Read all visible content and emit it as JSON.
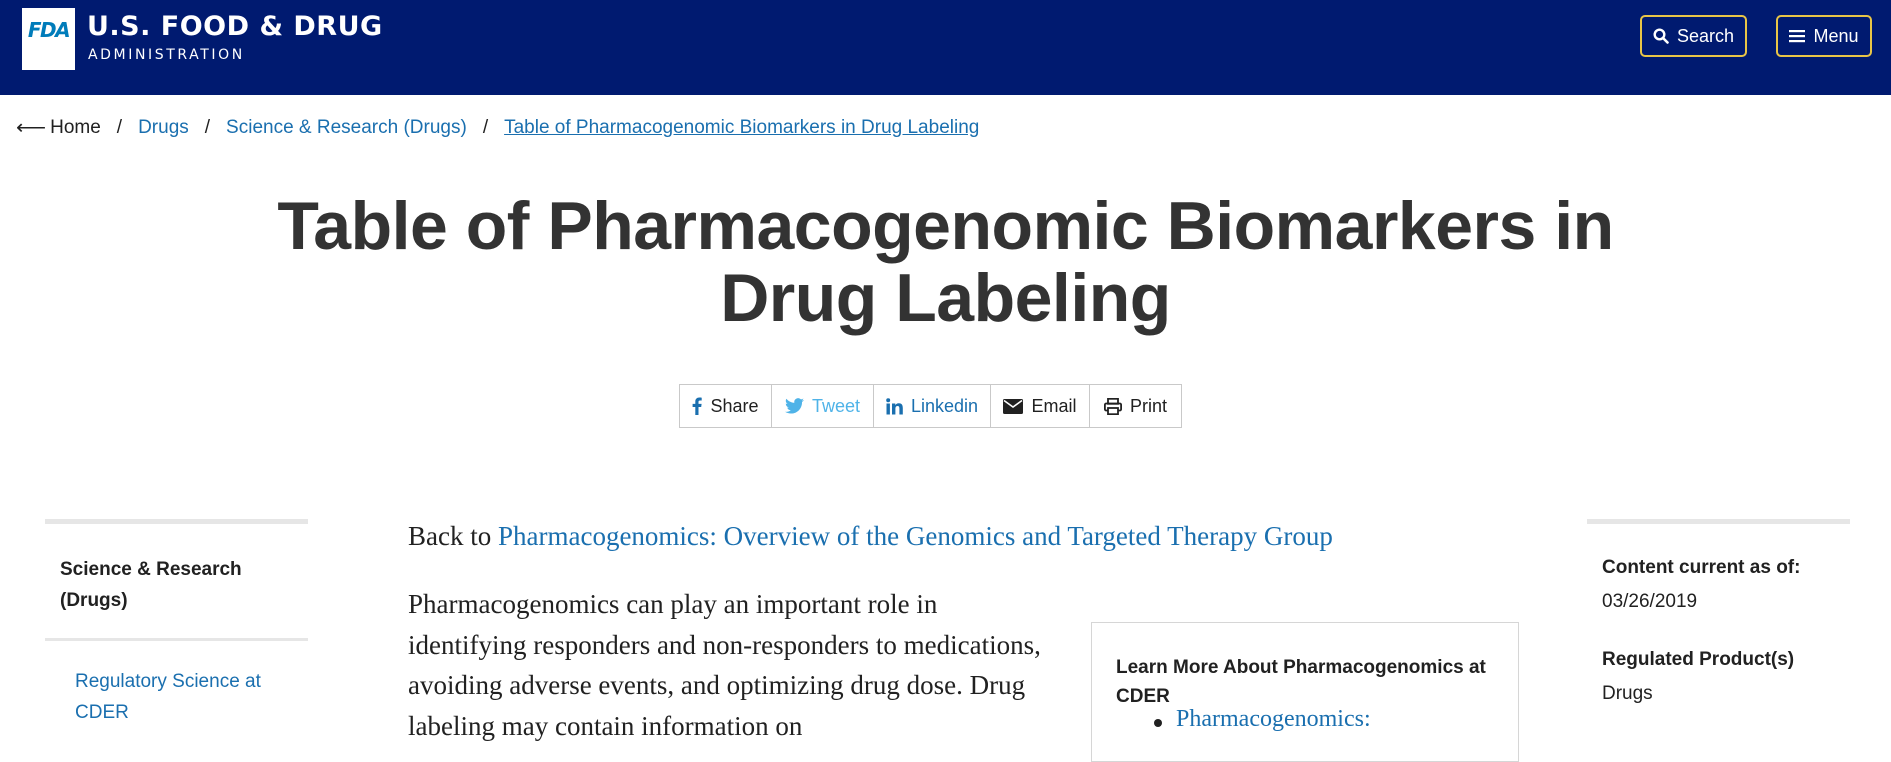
{
  "header": {
    "logo_text": "FDA",
    "org_name": "U.S. FOOD & DRUG",
    "org_sub": "ADMINISTRATION",
    "search_label": "Search",
    "menu_label": "Menu",
    "accent_color": "#e8c547",
    "bg_color": "#001a70"
  },
  "breadcrumb": {
    "back_icon": "arrow-left",
    "items": [
      "Home",
      "Drugs",
      "Science & Research (Drugs)",
      "Table of Pharmacogenomic Biomarkers in Drug Labeling"
    ],
    "separator": "/"
  },
  "page": {
    "title": "Table of Pharmacogenomic Biomarkers in Drug Labeling"
  },
  "share": {
    "facebook": "Share",
    "twitter": "Tweet",
    "linkedin": "Linkedin",
    "email": "Email",
    "print": "Print"
  },
  "left_nav": {
    "heading": "Science & Research (Drugs)",
    "items": [
      "Regulatory Science at CDER"
    ]
  },
  "main": {
    "back_prefix": "Back to",
    "back_link": "Pharmacogenomics: Overview of the Genomics and Targeted Therapy Group",
    "intro": "Pharmacogenomics can play an important role in identifying responders and non-responders to medications, avoiding adverse events, and optimizing drug dose. Drug labeling may contain information on"
  },
  "learn_more": {
    "title": "Learn More About Pharmacogenomics at CDER",
    "links": [
      "Pharmacogenomics:"
    ]
  },
  "meta": {
    "content_current_label": "Content current as of:",
    "content_current_value": "03/26/2019",
    "regulated_label": "Regulated Product(s)",
    "regulated_value": "Drugs"
  }
}
